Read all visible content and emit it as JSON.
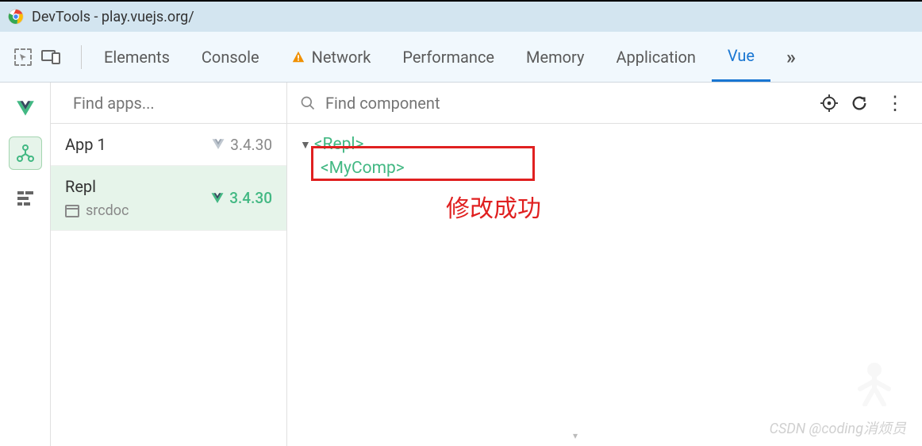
{
  "titlebar": {
    "text": "DevTools - play.vuejs.org/"
  },
  "tabs": {
    "items": [
      "Elements",
      "Console",
      "Network",
      "Performance",
      "Memory",
      "Application",
      "Vue"
    ],
    "active_index": 6,
    "more_label": "»"
  },
  "apps_panel": {
    "search_placeholder": "Find apps...",
    "items": [
      {
        "name": "App 1",
        "version": "3.4.30",
        "active": false
      },
      {
        "name": "Repl",
        "version": "3.4.30",
        "src": "srcdoc",
        "active": true
      }
    ]
  },
  "components_panel": {
    "search_placeholder": "Find component",
    "tree": {
      "root": "<Repl>",
      "child": "<MyComp>"
    }
  },
  "annotation": {
    "text": "修改成功"
  },
  "watermark": "CSDN @coding消烦员"
}
